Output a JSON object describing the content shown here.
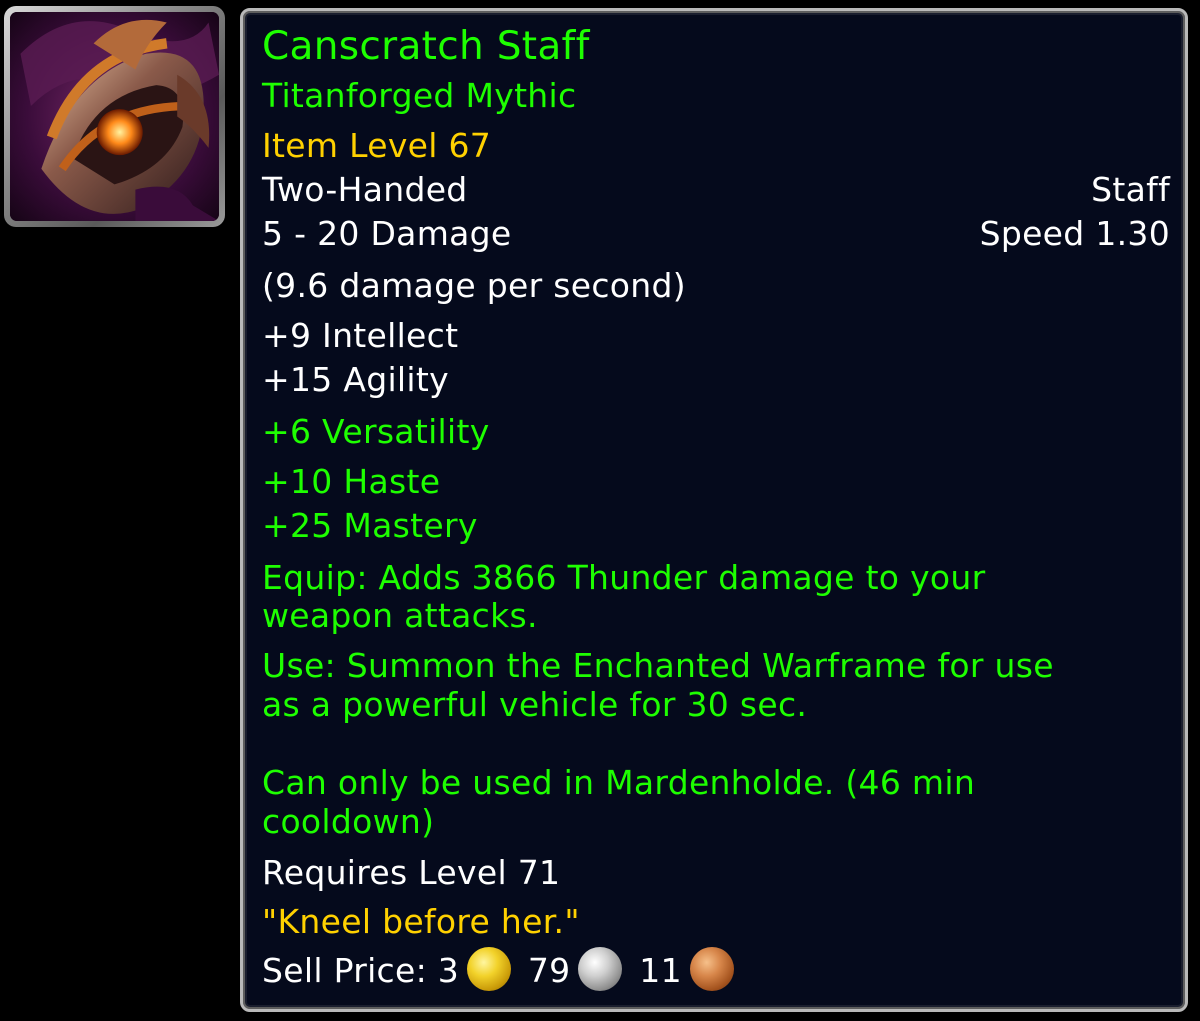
{
  "item": {
    "name": "Canscratch Staff",
    "upgrade": "Titanforged Mythic",
    "item_level": "Item Level 67",
    "slot": "Two-Handed",
    "type": "Staff",
    "damage": "5 - 20 Damage",
    "speed": "Speed 1.30",
    "dps": "(9.6 damage per second)",
    "stats_white": [
      "+9 Intellect",
      "+15 Agility"
    ],
    "stats_green": [
      "+6 Versatility",
      "+10 Haste",
      "+25 Mastery"
    ],
    "equip_line1": "Equip: Adds 3866 Thunder damage to your",
    "equip_line2": "weapon attacks.",
    "use_line1": "Use: Summon the Enchanted Warframe for use",
    "use_line2": "as a powerful vehicle for 30 sec.",
    "use_line3": "Can only be used in Mardenholde. (46 min",
    "use_line4": "cooldown)",
    "requires": "Requires Level 71",
    "flavor": "\"Kneel before her.\"",
    "sell_label": "Sell Price:",
    "sell_gold": "3",
    "sell_silver": "79",
    "sell_copper": "11",
    "icon": "staff-head-icon"
  },
  "colors": {
    "name": "#1eff00",
    "item_level": "#ffd100",
    "white_text": "#ffffff",
    "background": "#050a1c",
    "border": "#b9b9b9"
  }
}
